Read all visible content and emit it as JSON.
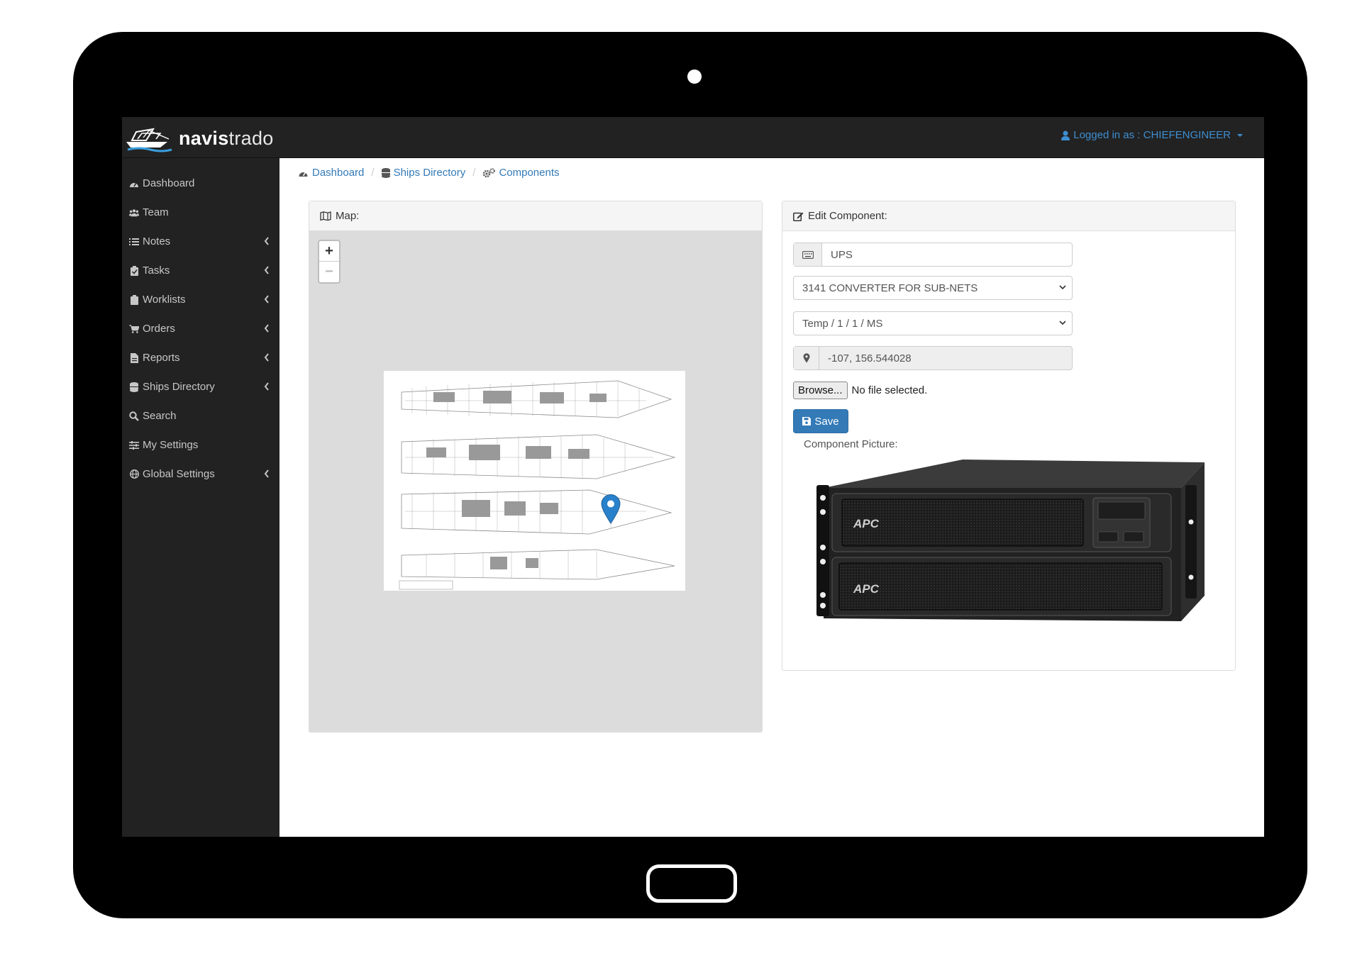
{
  "app": {
    "brand_bold": "navis",
    "brand_light": "trado",
    "user_label": "Logged in as : CHIEFENGINEER"
  },
  "sidebar": {
    "items": [
      {
        "label": "Dashboard",
        "icon": "dashboard-icon",
        "expandable": false
      },
      {
        "label": "Team",
        "icon": "users-icon",
        "expandable": false
      },
      {
        "label": "Notes",
        "icon": "list-icon",
        "expandable": true
      },
      {
        "label": "Tasks",
        "icon": "clipboard-check-icon",
        "expandable": true
      },
      {
        "label": "Worklists",
        "icon": "clipboard-icon",
        "expandable": true
      },
      {
        "label": "Orders",
        "icon": "cart-icon",
        "expandable": true
      },
      {
        "label": "Reports",
        "icon": "file-icon",
        "expandable": true
      },
      {
        "label": "Ships Directory",
        "icon": "database-icon",
        "expandable": true
      },
      {
        "label": "Search",
        "icon": "search-icon",
        "expandable": false
      },
      {
        "label": "My Settings",
        "icon": "sliders-icon",
        "expandable": false
      },
      {
        "label": "Global Settings",
        "icon": "globe-icon",
        "expandable": true
      }
    ]
  },
  "breadcrumb": {
    "items": [
      {
        "label": "Dashboard",
        "icon": "dashboard-icon"
      },
      {
        "label": "Ships Directory",
        "icon": "database-icon"
      },
      {
        "label": "Components",
        "icon": "cogs-icon"
      }
    ]
  },
  "map_panel": {
    "title": "Map:",
    "zoom_in": "+",
    "zoom_out": "−"
  },
  "edit_panel": {
    "title": "Edit Component:",
    "name_value": "UPS",
    "category_value": "3141 CONVERTER FOR SUB-NETS",
    "location_value": "Temp / 1 / 1 / MS",
    "coordinates_value": "-107, 156.544028",
    "browse_label": "Browse...",
    "file_status": "No file selected.",
    "save_label": "Save",
    "picture_label": "Component Picture:",
    "picture_brand": "APC"
  },
  "colors": {
    "sidebar_bg": "#222222",
    "link": "#337ab7",
    "primary_button": "#337ab7",
    "map_bg": "#dcdcdc",
    "marker": "#2a81cb"
  }
}
